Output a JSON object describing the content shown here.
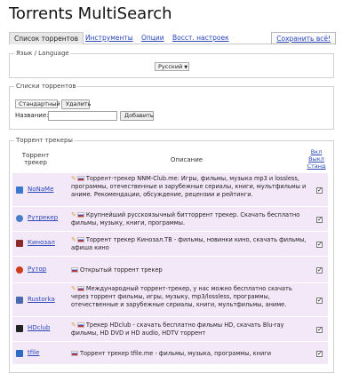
{
  "app": {
    "title": "Torrents MultiSearch"
  },
  "tabs": [
    {
      "label": "Список торрентов",
      "active": true
    },
    {
      "label": "Инструменты"
    },
    {
      "label": "Опции"
    },
    {
      "label": "Восст. настроек"
    }
  ],
  "save_all": "Сохранить всё!",
  "language": {
    "legend": "Язык / Language",
    "selected": "Русский"
  },
  "lists": {
    "legend": "Списки торрентов",
    "selected": "Стандартный",
    "delete_label": "Удалить",
    "name_label": "Название:",
    "name_value": "",
    "add_label": "Добавить"
  },
  "trackers": {
    "legend": "Торрент трекеры",
    "col_tracker": "Торрент трекер",
    "col_description": "Описание",
    "col_links": [
      "Вкл",
      "Выкл",
      "Станд"
    ],
    "rows": [
      {
        "name": "NoNaMe",
        "icon": "noname-icon",
        "color": "#3a78d0",
        "pen": true,
        "description": "Торрент-трекер NNM-Club.me: Игры, фильмы, музыка mp3 и lossless, программы, отечественные и зарубежные сериалы, книги, мультфильмы и аниме. Рекомендации, обсуждение, рецензии и рейтинги.",
        "checked": true
      },
      {
        "name": "Рутрекер",
        "icon": "rutracker-icon",
        "color": "#4a7dc9",
        "pen": true,
        "description": "Крупнейший русскоязычный битторрент трекер. Скачать бесплатно фильмы, музыку, книги, программы.",
        "checked": true
      },
      {
        "name": "Кинозал",
        "icon": "kinozal-icon",
        "color": "#8a2a2a",
        "pen": true,
        "description": "Торрент трекер Кинозал.ТВ - фильмы, новинки кино, скачать фильмы, афиша кино",
        "checked": true
      },
      {
        "name": "Рутор",
        "icon": "rutor-icon",
        "color": "#d23b1a",
        "pen": false,
        "description": "Открытый торрент трекер",
        "checked": true
      },
      {
        "name": "Rustorka",
        "icon": "rustorka-icon",
        "color": "#4a6ab0",
        "pen": true,
        "description": "Международный торрент-трекер, у нас можно бесплатно скачать через торрент фильмы, игры, музыку, mp3/lossless, программы, отечественные и зарубежные сериалы, книги, мультфильмы, аниме.",
        "checked": true
      },
      {
        "name": "HDclub",
        "icon": "hdclub-icon",
        "color": "#222222",
        "pen": true,
        "description": "Трекер HDclub - скачать бесплатно фильмы HD, скачать Blu-ray фильмы, HD DVD и HD audio, HDTV торрент",
        "checked": true
      },
      {
        "name": "tfile",
        "icon": "tfile-icon",
        "color": "#2f6bc4",
        "pen": false,
        "description": "Торрент трекер tfile.me - фильмы, музыка, программы, книги",
        "checked": true
      }
    ]
  }
}
